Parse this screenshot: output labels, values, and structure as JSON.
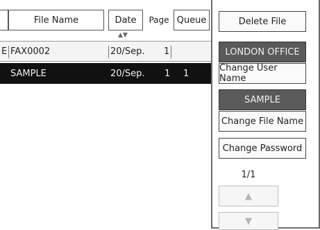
{
  "list": {
    "header": {
      "file_name": "File Name",
      "date": "Date",
      "date_sort": "▲▼",
      "page": "Page",
      "queue": "Queue"
    },
    "rows": [
      {
        "prefix": "E",
        "file_name": "FAX0002",
        "date": "20/Sep.",
        "page": "1",
        "queue": "",
        "selected": false
      },
      {
        "prefix": "",
        "file_name": "SAMPLE",
        "date": "20/Sep.",
        "page": "1",
        "queue": "1",
        "selected": true
      }
    ]
  },
  "panel": {
    "delete_file": "Delete File",
    "user_name_value": "LONDON OFFICE",
    "change_user_name": "Change User Name",
    "file_name_value": "SAMPLE",
    "change_file_name": "Change File Name",
    "change_password": "Change Password",
    "page_indicator": "1/1",
    "page_up": "▲",
    "page_down": "▼"
  }
}
